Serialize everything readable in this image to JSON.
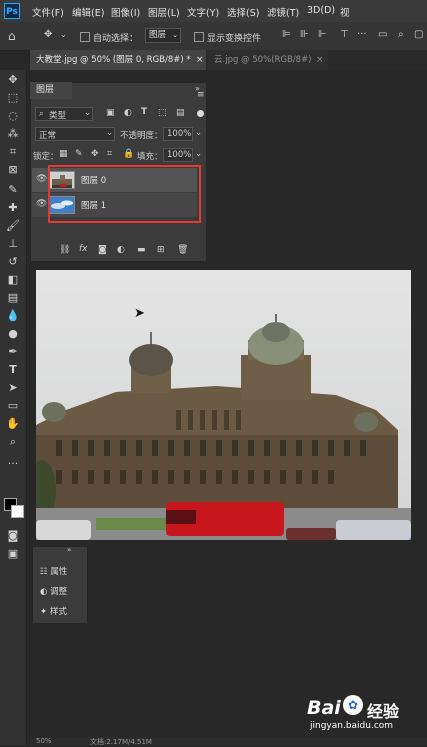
{
  "menubar": {
    "logo": "Ps",
    "items": [
      "文件(F)",
      "编辑(E)",
      "图像(I)",
      "图层(L)",
      "文字(Y)",
      "选择(S)",
      "滤镜(T)",
      "3D(D)",
      "视"
    ]
  },
  "optbar": {
    "auto_select_label": "自动选择：",
    "auto_select_value": "图层",
    "show_transform_label": "显示变换控件"
  },
  "tabs": [
    {
      "label": "大教堂.jpg @ 50% (图层 0, RGB/8#) *",
      "close": "×"
    },
    {
      "label": "云.jpg @ 50%(RGB/8#)",
      "close": "×"
    }
  ],
  "layers_panel": {
    "title": "图层",
    "filter_label": "类型",
    "blend_mode": "正常",
    "opacity_label": "不透明度：",
    "opacity_value": "100%",
    "lock_label": "锁定：",
    "fill_label": "填充：",
    "fill_value": "100%",
    "layers": [
      {
        "name": "图层 0"
      },
      {
        "name": "图层 1"
      }
    ]
  },
  "props_panel": {
    "items": [
      "属性",
      "调整",
      "样式"
    ]
  },
  "status": {
    "zoom": "50%",
    "doc": "文档:2.17M/4.51M"
  },
  "watermark": {
    "brand": "Bai",
    "brand_cn": "经验",
    "url": "jingyan.baidu.com"
  },
  "colors": {
    "highlight": "#e53935",
    "ps_blue": "#31a8ff",
    "truck_red": "#c8161d"
  }
}
